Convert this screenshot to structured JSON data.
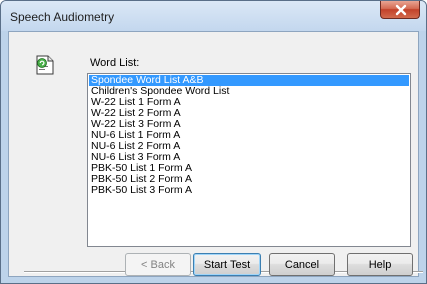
{
  "window": {
    "title": "Speech Audiometry"
  },
  "word_list": {
    "label": "Word List:",
    "items": [
      "Spondee Word List A&B",
      "Children's Spondee Word List",
      "W-22 List 1 Form A",
      "W-22 List 2 Form A",
      "W-22 List 3 Form A",
      "NU-6 List 1 Form A",
      "NU-6 List 2 Form A",
      "NU-6 List 3 Form A",
      "PBK-50 List 1 Form A",
      "PBK-50 List 2 Form A",
      "PBK-50 List 3 Form A"
    ],
    "selected": "Spondee Word List A&B"
  },
  "buttons": {
    "back": "< Back",
    "start_test": "Start Test",
    "cancel": "Cancel",
    "help": "Help"
  },
  "icons": {
    "app": "audiometry-document-icon",
    "close": "close-icon"
  },
  "colors": {
    "selection": "#3399ff",
    "close_button": "#c94a32",
    "title_bar": "#c9dbef"
  }
}
